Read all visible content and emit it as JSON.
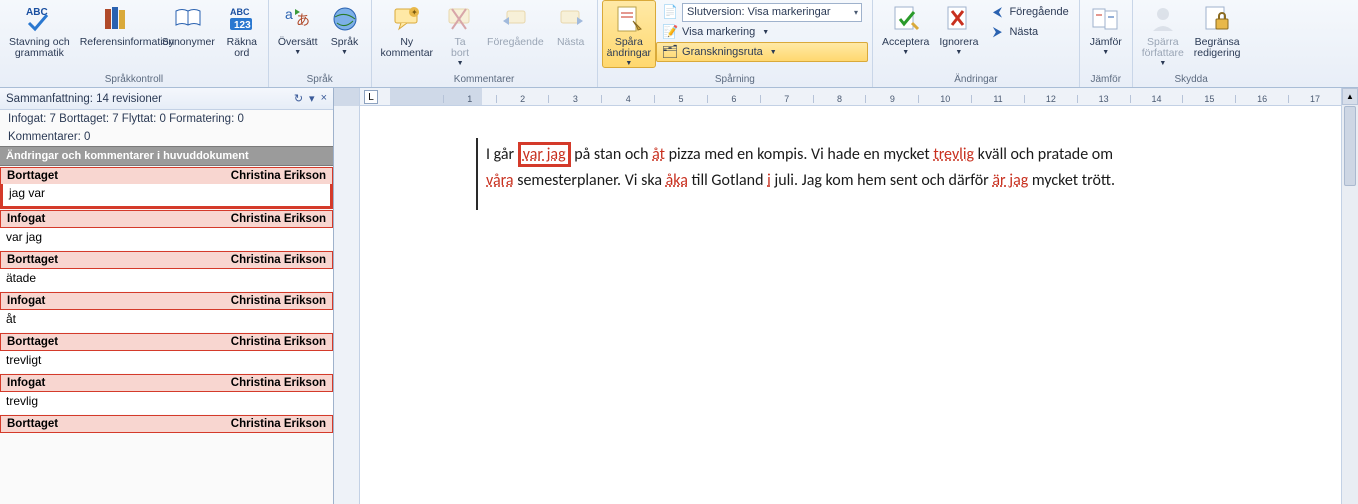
{
  "ribbon": {
    "groups": {
      "sprakkontroll": {
        "label": "Språkkontroll",
        "spelling": "Stavning och\ngrammatik",
        "research": "Referensinformation",
        "thesaurus": "Synonymer",
        "wordcount": "Räkna\nord"
      },
      "sprak": {
        "label": "Språk",
        "translate": "Översätt",
        "language": "Språk"
      },
      "kommentarer": {
        "label": "Kommentarer",
        "new": "Ny\nkommentar",
        "delete": "Ta\nbort",
        "prev": "Föregående",
        "next": "Nästa"
      },
      "sparning": {
        "label": "Spårning",
        "track": "Spåra\nändringar",
        "displayMode": "Slutversion: Visa markeringar",
        "showMarkup": "Visa markering",
        "reviewingPane": "Granskningsruta"
      },
      "andringar": {
        "label": "Ändringar",
        "accept": "Acceptera",
        "reject": "Ignorera",
        "previous": "Föregående",
        "next": "Nästa"
      },
      "jamfor": {
        "label": "Jämför",
        "compare": "Jämför"
      },
      "skydda": {
        "label": "Skydda",
        "block": "Spärra\nförfattare",
        "restrict": "Begränsa\nredigering"
      }
    }
  },
  "pane": {
    "summary": "Sammanfattning: 14 revisioner",
    "stats": "Infogat: 7  Borttaget: 7  Flyttat: 0  Formatering: 0",
    "comments": "Kommentarer: 0",
    "section": "Ändringar och kommentarer i huvuddokument",
    "author": "Christina Erikson",
    "rows": [
      {
        "type": "Borttaget",
        "text": "jag var"
      },
      {
        "type": "Infogat",
        "text": "var jag"
      },
      {
        "type": "Borttaget",
        "text": "ätade"
      },
      {
        "type": "Infogat",
        "text": "åt"
      },
      {
        "type": "Borttaget",
        "text": "trevligt"
      },
      {
        "type": "Infogat",
        "text": "trevlig"
      },
      {
        "type": "Borttaget",
        "text": ""
      }
    ]
  },
  "ruler": {
    "tab": "L",
    "numbers": [
      "",
      "1",
      "2",
      "3",
      "4",
      "5",
      "6",
      "7",
      "8",
      "9",
      "10",
      "11",
      "12",
      "13",
      "14",
      "15",
      "16",
      "17"
    ]
  },
  "doc": {
    "p1a": "I går ",
    "p1_hl": "var jag",
    "p1b": " på stan och ",
    "p1_ins1": "åt",
    "p1c": " pizza med en kompis. Vi hade en mycket ",
    "p1_ins2": "trevlig",
    "p1d": " kväll och pratade om ",
    "p2_ins1": "våra",
    "p2a": " semesterplaner. Vi ska ",
    "p2_ins2": "åka",
    "p2b": " till Gotland ",
    "p2_ins3": "i",
    "p2c": " juli. Jag kom hem sent och därför ",
    "p2_ins4": "är jag",
    "p2d": " mycket trött."
  }
}
